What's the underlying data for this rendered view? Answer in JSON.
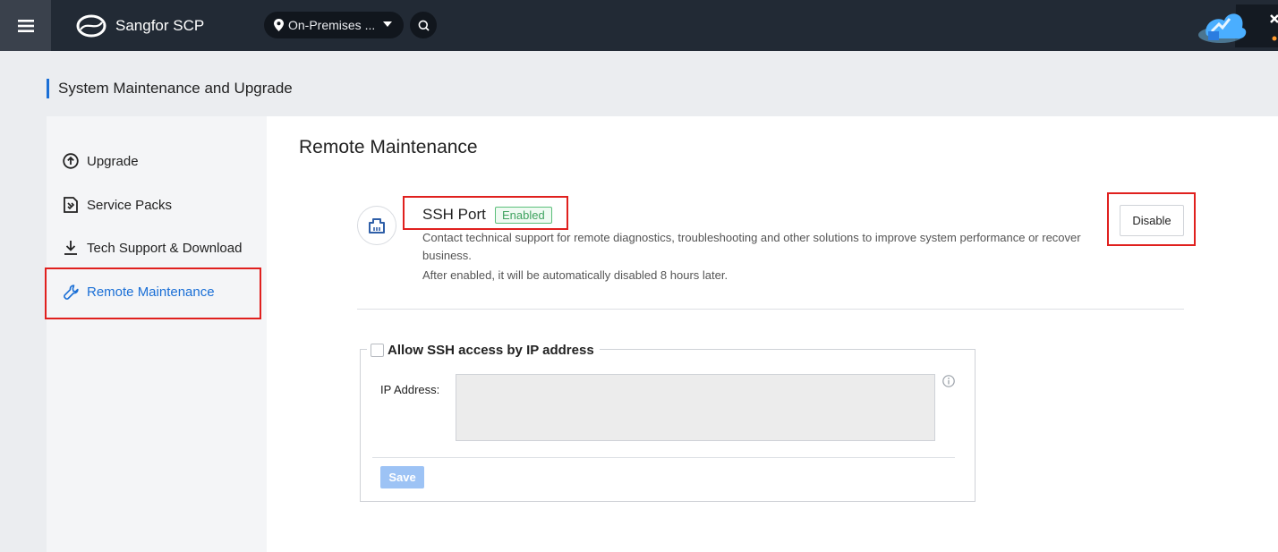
{
  "topbar": {
    "brand_name": "Sangfor SCP",
    "location_label": "On-Premises ...",
    "icons": [
      "menu-icon",
      "sangfor-logo",
      "location-pin-icon",
      "chevron-down-icon",
      "search-icon",
      "cloud-promo-icon"
    ]
  },
  "page": {
    "title": "System Maintenance and Upgrade"
  },
  "sidebar": {
    "items": [
      {
        "label": "Upgrade",
        "icon": "arrow-up-circle-icon",
        "active": false
      },
      {
        "label": "Service Packs",
        "icon": "document-patch-icon",
        "active": false
      },
      {
        "label": "Tech Support & Download",
        "icon": "download-icon",
        "active": false
      },
      {
        "label": "Remote Maintenance",
        "icon": "wrench-icon",
        "active": true
      }
    ]
  },
  "main": {
    "section_title": "Remote Maintenance",
    "ssh": {
      "title": "SSH Port",
      "status": "Enabled",
      "description": "Contact technical support for remote diagnostics, troubleshooting and other solutions to improve system performance or recover business.",
      "note": "After enabled, it will be automatically disabled 8 hours later.",
      "disable_label": "Disable",
      "icon": "network-port-icon"
    },
    "ip_access": {
      "checkbox_label": "Allow SSH access by IP address",
      "checked": false,
      "ip_label": "IP Address:",
      "ip_value": "",
      "save_label": "Save"
    }
  },
  "colors": {
    "accent": "#1a6fd6",
    "topbar": "#222a35",
    "highlight": "#e0201e",
    "enabled": "#3fa35f"
  }
}
